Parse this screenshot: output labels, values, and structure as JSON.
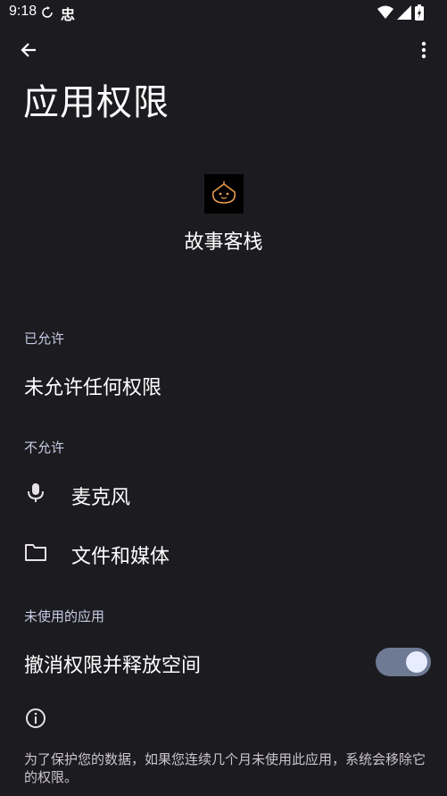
{
  "status_bar": {
    "time": "9:18",
    "app_glyph": "忠",
    "icons": [
      "sync-icon",
      "wifi-icon",
      "signal-icon",
      "battery-icon"
    ]
  },
  "toolbar": {
    "back_icon": "arrow-left-icon",
    "more_icon": "more-vert-icon"
  },
  "page": {
    "title": "应用权限"
  },
  "app": {
    "name": "故事客栈"
  },
  "sections": {
    "allowed": {
      "label": "已允许",
      "empty_text": "未允许任何权限"
    },
    "denied": {
      "label": "不允许",
      "items": [
        {
          "label": "麦克风",
          "icon": "microphone-icon"
        },
        {
          "label": "文件和媒体",
          "icon": "folder-icon"
        }
      ]
    },
    "unused": {
      "label": "未使用的应用",
      "toggle_label": "撤消权限并释放空间",
      "toggle_on": true
    }
  },
  "footer": {
    "info_icon": "info-icon",
    "text": "为了保护您的数据，如果您连续几个月未使用此应用，系统会移除它的权限。"
  },
  "colors": {
    "background": "#1c1b1f",
    "section_label": "#c8cbe5",
    "toggle_track": "#6e7a94",
    "toggle_thumb": "#e7ecff"
  }
}
